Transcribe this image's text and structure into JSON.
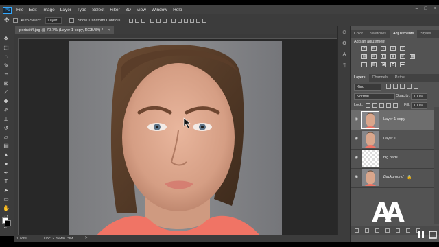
{
  "menubar": {
    "app_logo": "Ps",
    "items": [
      "File",
      "Edit",
      "Image",
      "Layer",
      "Type",
      "Select",
      "Filter",
      "3D",
      "View",
      "Window",
      "Help"
    ],
    "window_controls": [
      "–",
      "□",
      "×"
    ]
  },
  "options": {
    "auto_select_label": "Auto-Select:",
    "auto_select_value": "Layer",
    "transform_label": "Show Transform Controls"
  },
  "document": {
    "tab_title": "portrait4.jpg @ 70.7% (Layer 1 copy, RGB/8#) *",
    "tab_close": "×"
  },
  "status": {
    "zoom": "70.69%",
    "doc": "Doc: 2.26M/8.79M",
    "arrow": ">"
  },
  "panels": {
    "top_tabs": [
      "Color",
      "Swatches",
      "Adjustments",
      "Styles"
    ],
    "top_active": "Adjustments",
    "adjustments_title": "Add an adjustment",
    "layer_tabs": [
      "Layers",
      "Channels",
      "Paths"
    ],
    "layer_active": "Layers",
    "kind_filter": "Kind",
    "blend_mode": "Normal",
    "opacity_label": "Opacity:",
    "opacity_value": "100%",
    "lock_label": "Lock:",
    "fill_label": "Fill:",
    "fill_value": "100%"
  },
  "layers": [
    {
      "name": "Layer 1 copy",
      "selected": true,
      "italic": false,
      "thumb": "face"
    },
    {
      "name": "Layer 1",
      "selected": false,
      "italic": false,
      "thumb": "face"
    },
    {
      "name": "big bads",
      "selected": false,
      "italic": false,
      "thumb": "transparent"
    },
    {
      "name": "Background",
      "selected": false,
      "italic": true,
      "thumb": "face",
      "locked": true
    }
  ],
  "colors": {
    "ui_dark": "#3c3c3c",
    "panel": "#535353",
    "accent": "#31a8ff",
    "selected_layer": "#6d6d6d"
  },
  "watermark": "AA"
}
